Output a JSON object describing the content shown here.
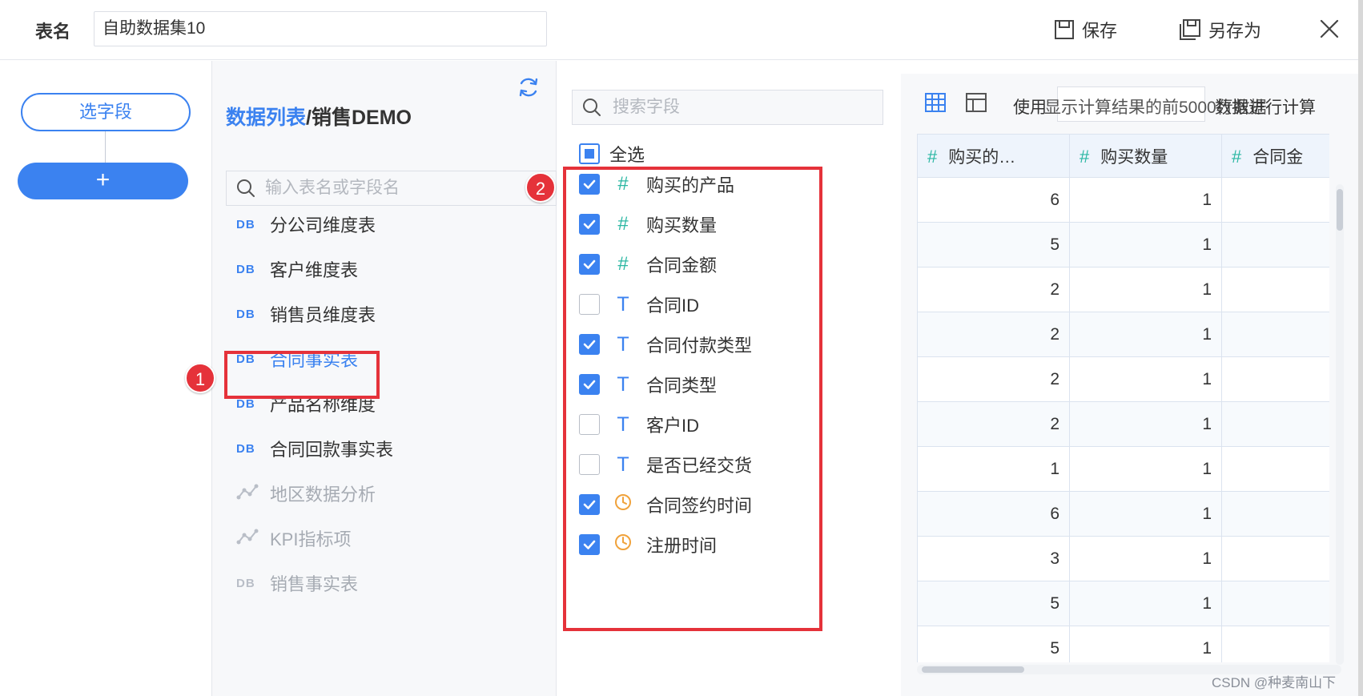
{
  "topbar": {
    "table_name_label": "表名",
    "table_name_value": "自助数据集10",
    "save_label": "保存",
    "save_as_label": "另存为"
  },
  "steps": {
    "current_step_label": "选字段",
    "add_step_label": "+"
  },
  "data_list": {
    "breadcrumb_root": "数据列表",
    "breadcrumb_separator": "/",
    "breadcrumb_current": "销售DEMO",
    "search_placeholder": "输入表名或字段名",
    "items": [
      {
        "label": "分公司维度表",
        "icon": "db-icon",
        "state": "normal"
      },
      {
        "label": "客户维度表",
        "icon": "db-icon",
        "state": "normal"
      },
      {
        "label": "销售员维度表",
        "icon": "db-icon",
        "state": "normal"
      },
      {
        "label": "合同事实表",
        "icon": "db-icon",
        "state": "active"
      },
      {
        "label": "产品名称维度",
        "icon": "db-icon",
        "state": "normal"
      },
      {
        "label": "合同回款事实表",
        "icon": "db-icon",
        "state": "normal"
      },
      {
        "label": "地区数据分析",
        "icon": "analysis-icon",
        "state": "disabled"
      },
      {
        "label": "KPI指标项",
        "icon": "analysis-icon",
        "state": "disabled"
      },
      {
        "label": "销售事实表",
        "icon": "db-icon",
        "state": "disabled"
      }
    ],
    "db_icon_text": "DB"
  },
  "fields": {
    "search_placeholder": "搜索字段",
    "select_all_label": "全选",
    "items": [
      {
        "label": "购买的产品",
        "type": "number",
        "checked": true
      },
      {
        "label": "购买数量",
        "type": "number",
        "checked": true
      },
      {
        "label": "合同金额",
        "type": "number",
        "checked": true
      },
      {
        "label": "合同ID",
        "type": "text",
        "checked": false
      },
      {
        "label": "合同付款类型",
        "type": "text",
        "checked": true
      },
      {
        "label": "合同类型",
        "type": "text",
        "checked": true
      },
      {
        "label": "客户ID",
        "type": "text",
        "checked": false
      },
      {
        "label": "是否已经交货",
        "type": "text",
        "checked": false
      },
      {
        "label": "合同签约时间",
        "type": "time",
        "checked": true
      },
      {
        "label": "注册时间",
        "type": "time",
        "checked": true
      }
    ],
    "type_glyphs": {
      "number": "#",
      "text": "T"
    }
  },
  "annotations": {
    "badge_1": "1",
    "badge_2": "2",
    "highlight_color": "#e5323a"
  },
  "preview": {
    "toolbar_text_left": "使用",
    "toolbar_text_overlap": "显示计算结果的前5000行数据",
    "toolbar_text_right": "数据进行计算",
    "columns": [
      "购买的…",
      "购买数量",
      "合同金"
    ],
    "column_type_glyph": "#",
    "rows": [
      [
        "6",
        "1",
        ""
      ],
      [
        "5",
        "1",
        ""
      ],
      [
        "2",
        "1",
        ""
      ],
      [
        "2",
        "1",
        ""
      ],
      [
        "2",
        "1",
        ""
      ],
      [
        "2",
        "1",
        ""
      ],
      [
        "1",
        "1",
        ""
      ],
      [
        "6",
        "1",
        ""
      ],
      [
        "3",
        "1",
        ""
      ],
      [
        "5",
        "1",
        ""
      ],
      [
        "5",
        "1",
        ""
      ]
    ]
  },
  "colors": {
    "accent": "#3b82f0",
    "number_type": "#2bb7a3",
    "time_type": "#f0a23b",
    "annotation_red": "#e5323a"
  },
  "watermark": "CSDN @种麦南山下"
}
